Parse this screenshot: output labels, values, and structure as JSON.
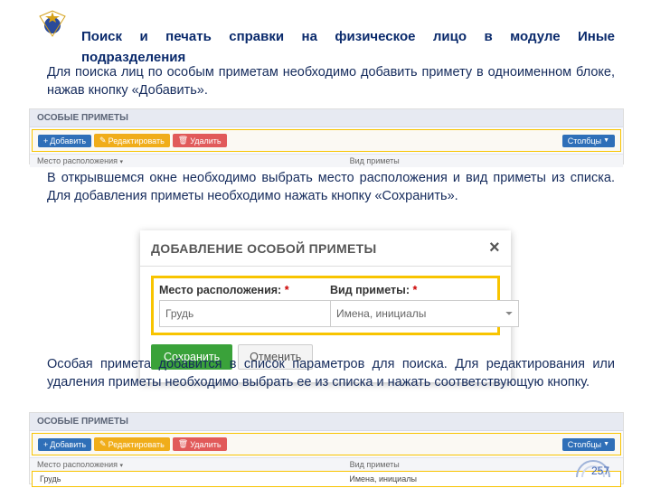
{
  "title_line1": "Поиск и печать справки на физическое лицо в модуле Иные",
  "title_line2": "подразделения",
  "p1": "Для поиска лиц по особым приметам необходимо добавить примету в одноименном блоке, нажав кнопку «Добавить».",
  "p2": "В открывшемся окне необходимо выбрать место расположения и вид приметы из списка. Для добавления приметы необходимо нажать кнопку «Сохранить».",
  "p3": "Особая примета добавится в список параметров для поиска. Для редактирования или удаления приметы необходимо выбрать ее из списка и нажать соответствующую кнопку.",
  "panel_title": "ОСОБЫЕ ПРИМЕТЫ",
  "btn_add": "Добавить",
  "btn_edit": "Редактировать",
  "btn_del": "Удалить",
  "btn_cols": "Столбцы",
  "col_loc": "Место расположения",
  "col_view": "Вид приметы",
  "row_loc": "Грудь",
  "row_view": "Имена, инициалы",
  "dlg_title": "ДОБАВЛЕНИЕ ОСОБОЙ ПРИМЕТЫ",
  "lbl_loc": "Место расположения:",
  "lbl_view": "Вид приметы:",
  "val_loc": "Грудь",
  "val_view": "Имена, инициалы",
  "save": "Сохранить",
  "cancel": "Отменить",
  "pagenum": "257"
}
